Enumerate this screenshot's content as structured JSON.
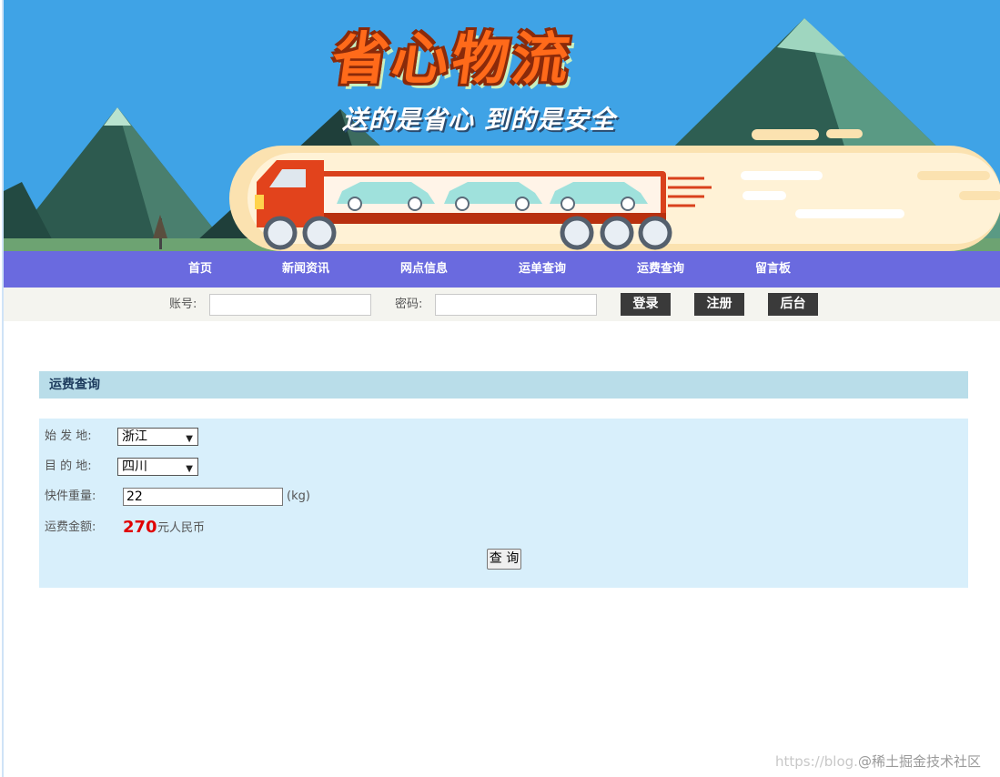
{
  "banner": {
    "title": "省心物流",
    "slogan": "送的是省心 到的是安全"
  },
  "nav": {
    "items": [
      "首页",
      "新闻资讯",
      "网点信息",
      "运单查询",
      "运费查询",
      "留言板"
    ]
  },
  "login": {
    "account_label": "账号:",
    "password_label": "密码:",
    "account_value": "",
    "password_value": "",
    "login_btn": "登录",
    "register_btn": "注册",
    "admin_btn": "后台"
  },
  "section": {
    "title": "运费查询"
  },
  "form": {
    "origin_label": "始 发 地:",
    "origin_value": "浙江",
    "dest_label": "目 的 地:",
    "dest_value": "四川",
    "weight_label": "快件重量:",
    "weight_value": "22",
    "weight_unit": "(kg)",
    "fee_label": "运费金额:",
    "fee_amount": "270",
    "fee_currency": "元人民币",
    "query_btn": "查 询"
  },
  "watermark": {
    "url_text": "https://blog.",
    "site_text": "@稀土掘金技术社区"
  },
  "colors": {
    "nav_bg": "#6a6adf",
    "section_head_bg": "#b9dde9",
    "form_bg": "#d8effb",
    "fee_amount": "#e00000",
    "banner_sky": "#3fa3e6"
  }
}
